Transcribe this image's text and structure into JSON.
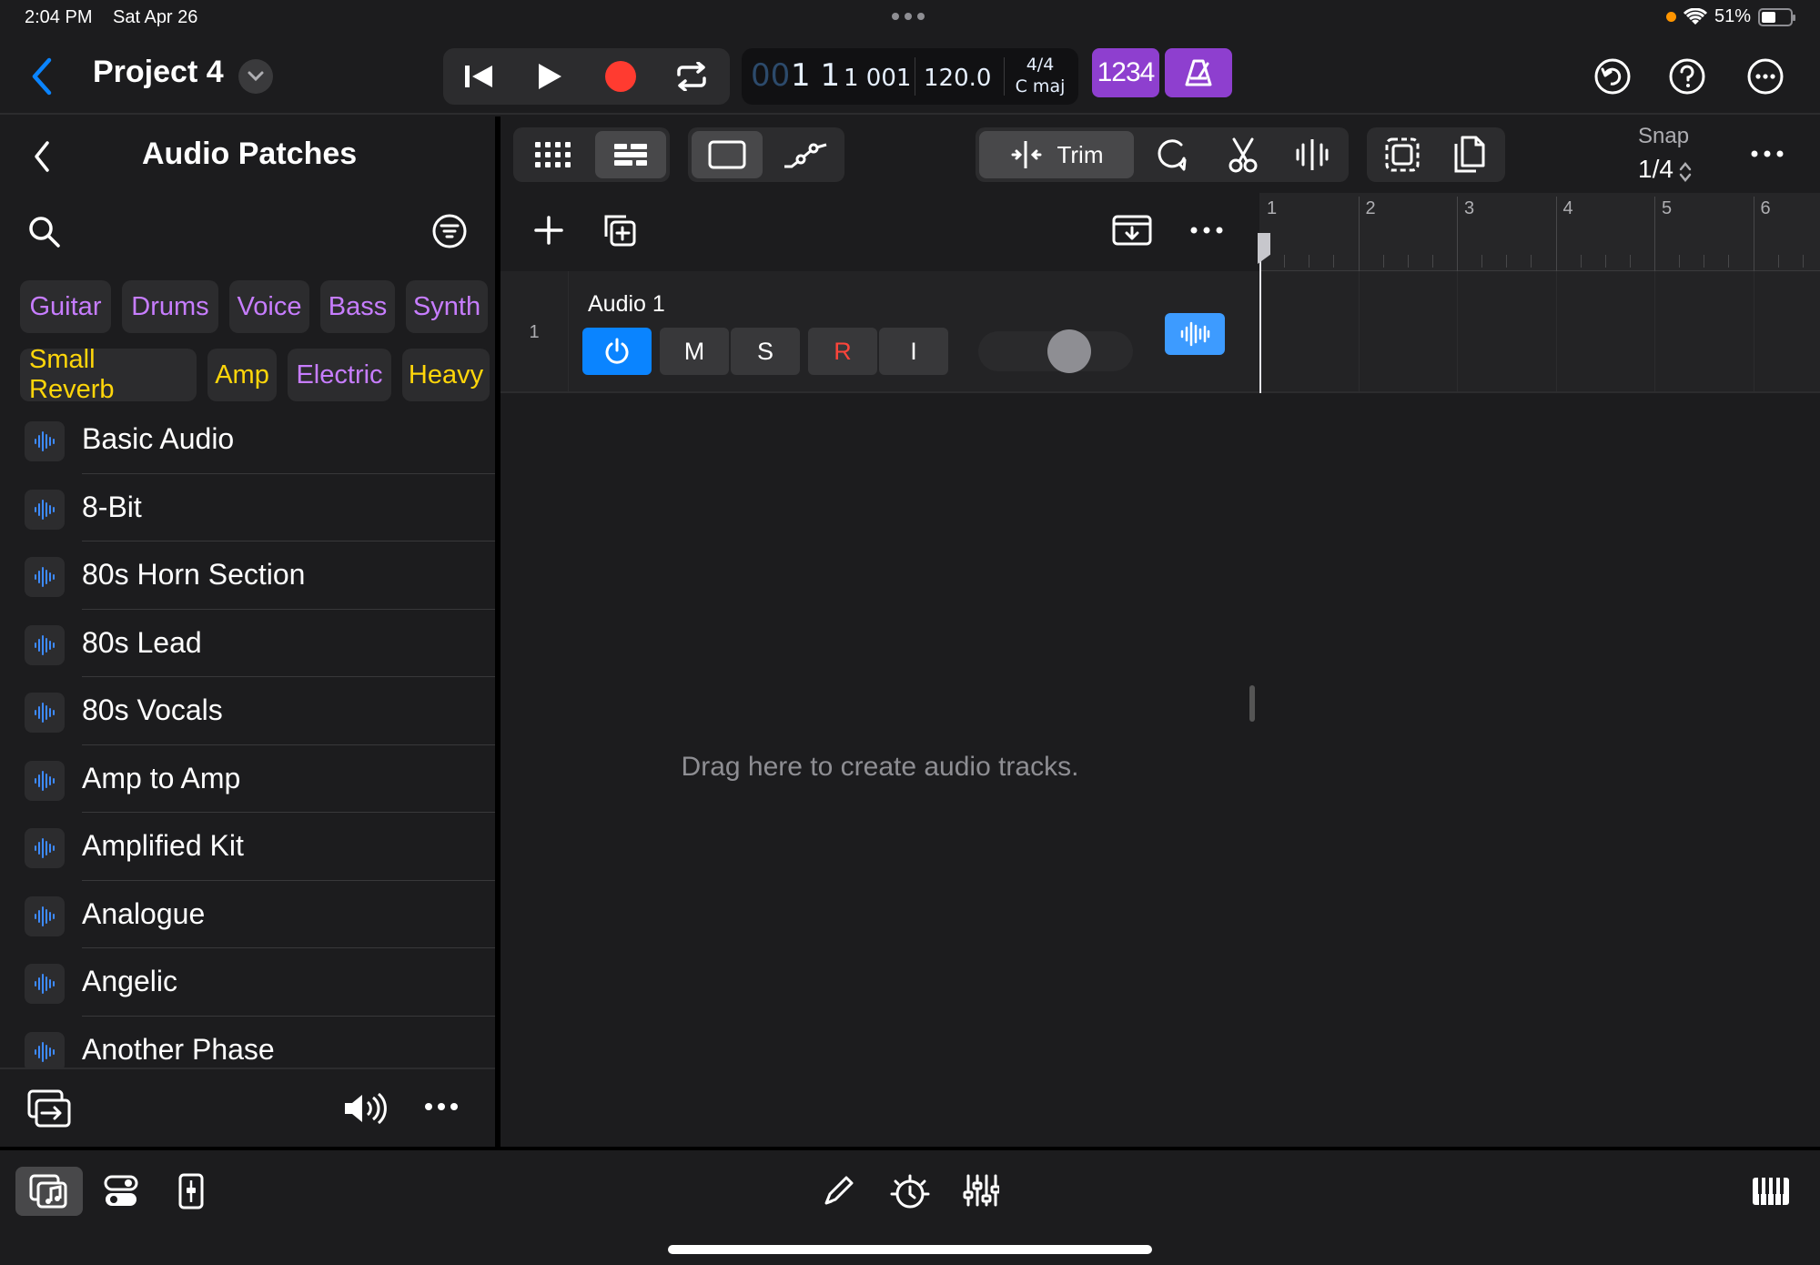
{
  "status_bar": {
    "time": "2:04 PM",
    "date": "Sat Apr 26",
    "battery": "51%",
    "battery_level": 0.51
  },
  "header": {
    "project_title": "Project 4"
  },
  "lcd": {
    "pos_dim": "00",
    "pos_bar": "1 1",
    "pos_beat": "1 001",
    "tempo": "120.0",
    "signature": "4/4",
    "key": "C maj"
  },
  "count_in": {
    "label": "1234"
  },
  "audio_patches": {
    "title": "Audio Patches",
    "filter_chips_row1": [
      "Guitar",
      "Drums",
      "Voice",
      "Bass",
      "Synth"
    ],
    "filter_chips_row2": [
      "Small Reverb",
      "Amp",
      "Electric",
      "Heavy"
    ],
    "patches": [
      "Basic Audio",
      "8-Bit",
      "80s Horn Section",
      "80s Lead",
      "80s Vocals",
      "Amp to Amp",
      "Amplified Kit",
      "Analogue",
      "Angelic",
      "Another Phase"
    ]
  },
  "toolbar": {
    "trim_label": "Trim",
    "snap_label": "Snap",
    "snap_value": "1/4"
  },
  "tracks": [
    {
      "number": "1",
      "name": "Audio 1",
      "mute": "M",
      "solo": "S",
      "record": "R",
      "input": "I",
      "volume": 0.62
    }
  ],
  "empty_hint": "Drag here to create audio tracks.",
  "ruler": {
    "bars": [
      "1",
      "2",
      "3",
      "4",
      "5",
      "6"
    ]
  },
  "colors": {
    "accent_blue": "#0a84ff",
    "purple": "#8e3fcf",
    "record_red": "#ff3b30",
    "chip_purple": "#c77dff",
    "chip_yellow": "#ffd60a"
  }
}
